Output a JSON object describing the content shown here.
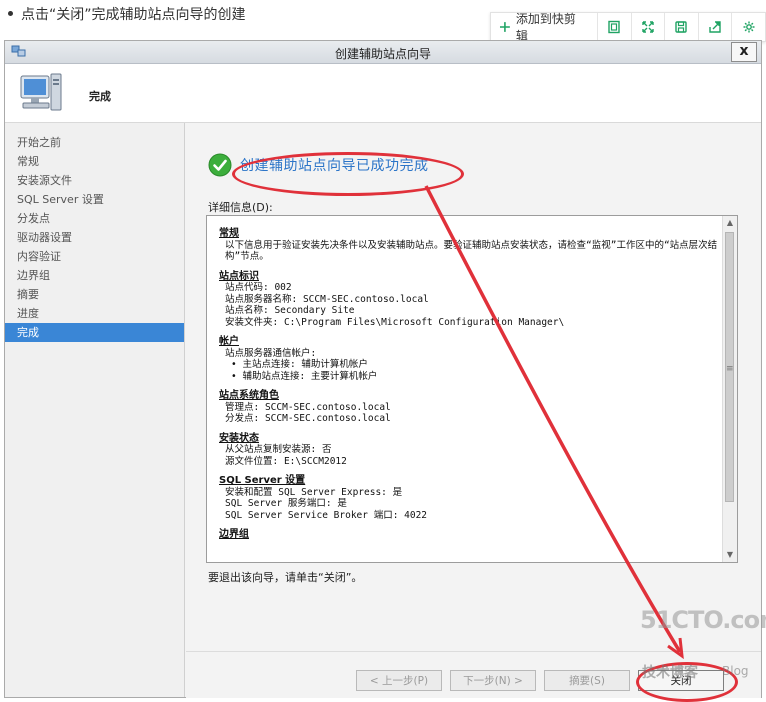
{
  "caption": "点击“关闭”完成辅助站点向导的创建",
  "toolbar": {
    "add_label": "添加到快剪辑",
    "icons": [
      "square-icon",
      "expand-icon",
      "save-icon",
      "share-icon",
      "settings-icon"
    ],
    "accent": "#1fa363"
  },
  "window": {
    "title": "创建辅助站点向导",
    "close_label": "x",
    "header_title": "完成"
  },
  "nav": {
    "items": [
      "开始之前",
      "常规",
      "安装源文件",
      "SQL Server 设置",
      "分发点",
      "驱动器设置",
      "内容验证",
      "边界组",
      "摘要",
      "进度",
      "完成"
    ],
    "active_index": 10
  },
  "main": {
    "success_text": "创建辅助站点向导已成功完成",
    "details_label": "详细信息(D):",
    "exit_note": "要退出该向导，请单击“关闭”。"
  },
  "details": [
    {
      "heading": "常规",
      "lines": [
        "以下信息用于验证安装先决条件以及安装辅助站点。要验证辅助站点安装状态，请检查“监视”工作区中的“站点层次结构”节点。"
      ],
      "wrap": true
    },
    {
      "heading": "站点标识",
      "lines": [
        "站点代码: 002",
        "站点服务器名称: SCCM-SEC.contoso.local",
        "站点名称: Secondary Site",
        "安装文件夹: C:\\Program Files\\Microsoft Configuration Manager\\"
      ]
    },
    {
      "heading": "帐户",
      "lines": [
        "站点服务器通信帐户:"
      ],
      "bullets": [
        "主站点连接: 辅助计算机帐户",
        "辅助站点连接: 主要计算机帐户"
      ]
    },
    {
      "heading": "站点系统角色",
      "lines": [
        "管理点: SCCM-SEC.contoso.local",
        "分发点: SCCM-SEC.contoso.local"
      ]
    },
    {
      "heading": "安装状态",
      "lines": [
        "从父站点复制安装源: 否",
        "源文件位置: E:\\SCCM2012"
      ]
    },
    {
      "heading": "SQL Server 设置",
      "lines": [
        "安装和配置 SQL Server Express: 是",
        "SQL Server 服务端口: 是",
        "SQL Server Service Broker 端口: 4022"
      ]
    },
    {
      "heading": "边界组",
      "lines": []
    }
  ],
  "buttons": {
    "prev": "< 上一步(P)",
    "next": "下一步(N) >",
    "summary": "摘要(S)",
    "close": "关闭"
  },
  "watermark": {
    "site": "51CTO.com",
    "sub": "技术博客",
    "blog": "Blog"
  },
  "colors": {
    "annotation_red": "#e0313a",
    "nav_active": "#3a86d6",
    "success_text": "#2c75c8"
  }
}
